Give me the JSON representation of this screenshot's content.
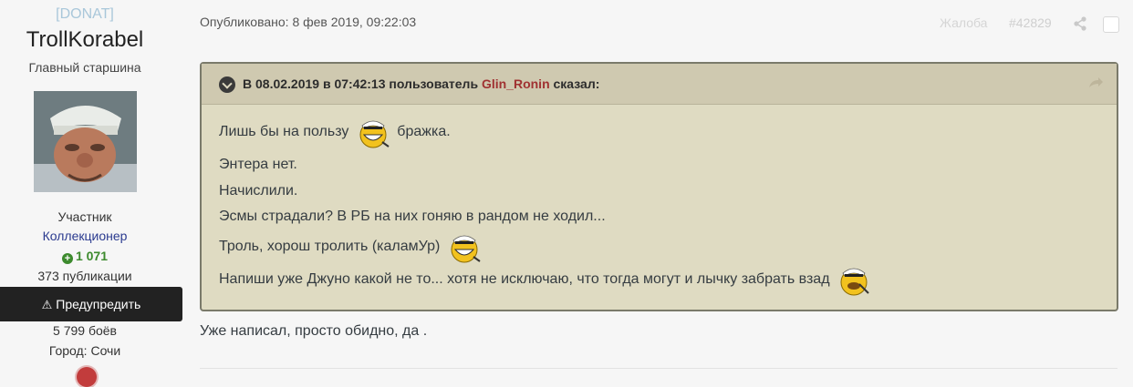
{
  "author": {
    "clan": "[DONAT]",
    "username": "TrollKorabel",
    "rank_title": "Главный старшина",
    "group": "Участник",
    "secondary_group": "Коллекционер",
    "reputation": "1 071",
    "posts": "373 публикации",
    "warn_button": "Предупредить",
    "battles": "5 799 боёв",
    "city": "Город: Сочи"
  },
  "post": {
    "published": "Опубликовано: 8 фев 2019, 09:22:03",
    "report_label": "Жалоба",
    "post_id": "#42829",
    "quote": {
      "header_prefix": "В 08.02.2019 в 07:42:13 пользователь",
      "quoted_user": "Glin_Ronin",
      "header_suffix": "сказал:",
      "lines": [
        "Лишь бы на пользу",
        "бражка.",
        "Энтера нет.",
        "Начислили.",
        "Эсмы страдали? В РБ на них гоняю в рандом не ходил...",
        "Троль, хорош тролить (каламУр)",
        "Напиши уже Джуно какой не то... хотя не исключаю, что тогда могут и лычку забрать взад"
      ]
    },
    "reply": "Уже написал, просто обидно, да ."
  },
  "icons": {
    "toggle": "chevron-down-circle-icon",
    "jump": "arrow-jump-icon",
    "share": "share-icon",
    "smiley": "sailor-smiley-icon",
    "warn": "warning-triangle-icon",
    "reputation": "plus-circle-icon"
  },
  "colors": {
    "quote_bg": "#dfdbc2",
    "quote_header_bg": "#cfc9b0",
    "quoted_user": "#a03232",
    "clan": "#a9c7da",
    "reputation": "#3c8a2d",
    "secondary_group": "#2a3a8f"
  }
}
